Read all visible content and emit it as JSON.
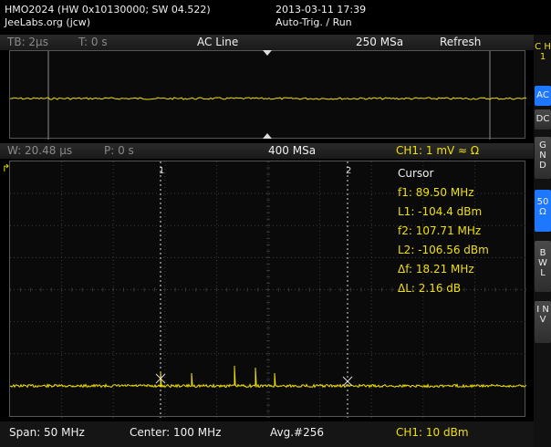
{
  "header": {
    "device_line": "HMO2024 (HW 0x10130000; SW 04.522)",
    "owner_line": "JeeLabs.org (jcw)",
    "datetime": "2013-03-11 17:39",
    "mode": "Auto-Trig. / Run"
  },
  "top_bar": {
    "timebase": "TB: 2µs",
    "trigger_time": "T: 0 s",
    "trigger_source": "AC Line",
    "sample_rate": "250 MSa",
    "refresh": "Refresh"
  },
  "mid_bar": {
    "window": "W: 20.48 µs",
    "position": "P: 0 s",
    "sample_rate": "400 MSa",
    "channel": "CH1: 1 mV ≈ Ω"
  },
  "cursor_readout": {
    "title": "Cursor",
    "f1": "f1: 89.50 MHz",
    "l1": "L1: -104.4 dBm",
    "f2": "f2: 107.71 MHz",
    "l2": "L2: -106.56 dBm",
    "df": "Δf: 18.21 MHz",
    "dl": "ΔL: 2.16 dB"
  },
  "cursor_markers": {
    "one": "1",
    "two": "2"
  },
  "bottom_bar": {
    "span": "Span: 50 MHz",
    "center": "Center: 100 MHz",
    "avg": "Avg.#256",
    "channel_scale": "CH1: 10 dBm"
  },
  "sidebar": {
    "channel": "C H 1",
    "ac": "AC",
    "dc": "DC",
    "gnd": "G N D",
    "fifty_ohm": "50 Ω",
    "bwl": "B W L",
    "inv": "I N V"
  },
  "colors": {
    "trace": "#f0e000",
    "active_button": "#1e78ff",
    "grid": "#3a3a3a"
  }
}
